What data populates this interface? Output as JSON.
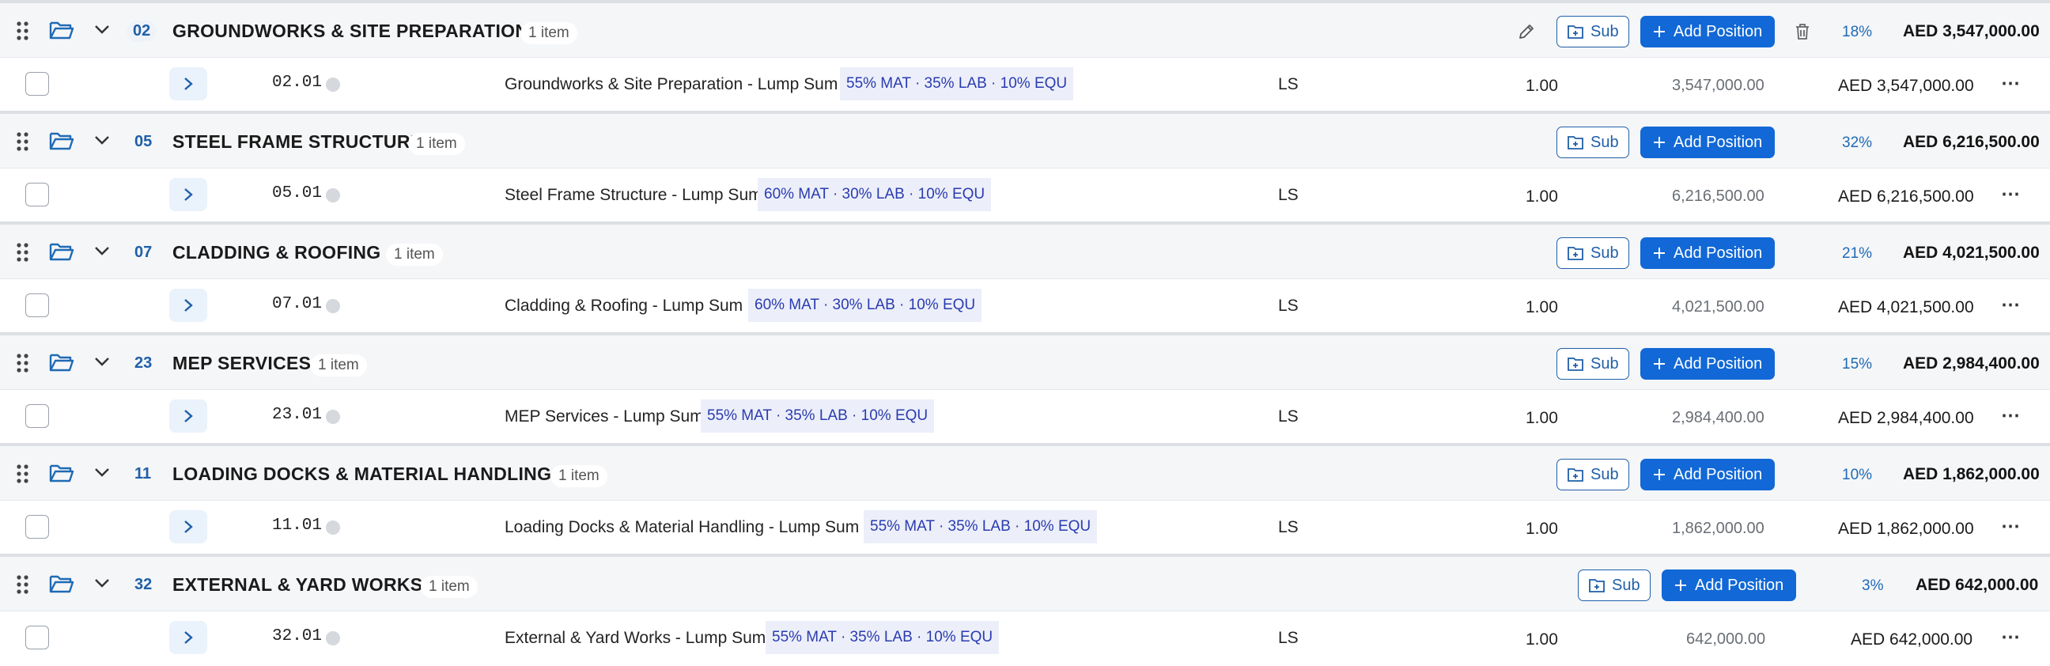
{
  "groups": [
    {
      "code": "02",
      "title": "GROUNDWORKS & SITE PREPARATION",
      "count": "1 item",
      "sub_label": "Sub",
      "add_label": "Add Position",
      "percent": "18%",
      "total": "AED 3,547,000.00",
      "item": {
        "code": "02.01",
        "description": "Groundworks & Site Preparation - Lump Sum",
        "mix": "55% MAT · 35% LAB · 10% EQU",
        "unit": "LS",
        "qty": "1.00",
        "rate": "3,547,000.00",
        "total": "AED 3,547,000.00"
      }
    },
    {
      "code": "05",
      "title": "STEEL FRAME STRUCTURE",
      "count": "1 item",
      "sub_label": "Sub",
      "add_label": "Add Position",
      "percent": "32%",
      "total": "AED 6,216,500.00",
      "item": {
        "code": "05.01",
        "description": "Steel Frame Structure - Lump Sum",
        "mix": "60% MAT · 30% LAB · 10% EQU",
        "unit": "LS",
        "qty": "1.00",
        "rate": "6,216,500.00",
        "total": "AED 6,216,500.00"
      }
    },
    {
      "code": "07",
      "title": "CLADDING & ROOFING",
      "count": "1 item",
      "sub_label": "Sub",
      "add_label": "Add Position",
      "percent": "21%",
      "total": "AED 4,021,500.00",
      "item": {
        "code": "07.01",
        "description": "Cladding & Roofing - Lump Sum",
        "mix": "60% MAT · 30% LAB · 10% EQU",
        "unit": "LS",
        "qty": "1.00",
        "rate": "4,021,500.00",
        "total": "AED 4,021,500.00"
      }
    },
    {
      "code": "23",
      "title": "MEP SERVICES",
      "count": "1 item",
      "sub_label": "Sub",
      "add_label": "Add Position",
      "percent": "15%",
      "total": "AED 2,984,400.00",
      "item": {
        "code": "23.01",
        "description": "MEP Services - Lump Sum",
        "mix": "55% MAT · 35% LAB · 10% EQU",
        "unit": "LS",
        "qty": "1.00",
        "rate": "2,984,400.00",
        "total": "AED 2,984,400.00"
      }
    },
    {
      "code": "11",
      "title": "LOADING DOCKS & MATERIAL HANDLING",
      "count": "1 item",
      "sub_label": "Sub",
      "add_label": "Add Position",
      "percent": "10%",
      "total": "AED 1,862,000.00",
      "item": {
        "code": "11.01",
        "description": "Loading Docks & Material Handling - Lump Sum",
        "mix": "55% MAT · 35% LAB · 10% EQU",
        "unit": "LS",
        "qty": "1.00",
        "rate": "1,862,000.00",
        "total": "AED 1,862,000.00"
      }
    },
    {
      "code": "32",
      "title": "EXTERNAL & YARD WORKS",
      "count": "1 item",
      "sub_label": "Sub",
      "add_label": "Add Position",
      "percent": "3%",
      "total": "AED 642,000.00",
      "item": {
        "code": "32.01",
        "description": "External & Yard Works - Lump Sum",
        "mix": "55% MAT · 35% LAB · 10% EQU",
        "unit": "LS",
        "qty": "1.00",
        "rate": "642,000.00",
        "total": "AED 642,000.00"
      }
    }
  ],
  "colors": {
    "accent": "#1168d6",
    "code_blue": "#1f5fa8",
    "mix_text": "#2a3bb0",
    "mix_bg": "#eceff9",
    "group_bg": "#f5f6f8"
  },
  "icons": [
    "drag-handle-icon",
    "folder-open-icon",
    "chevron-down-icon",
    "chevron-right-icon",
    "folder-plus-icon",
    "plus-icon",
    "pencil-icon",
    "trash-icon",
    "more-icon",
    "status-dot-icon"
  ]
}
